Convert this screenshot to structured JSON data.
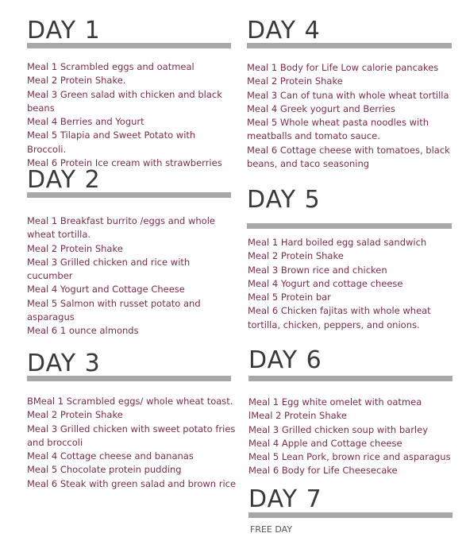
{
  "days": [
    {
      "title": "DAY 1",
      "meals": [
        "Meal 1 Scrambled eggs and oatmeal",
        "Meal 2 Protein Shake.",
        "Meal 3 Green salad with chicken and black beans",
        "Meal 4 Berries and Yogurt",
        "Meal 5 Tilapia and Sweet Potato with Broccoli.",
        "Meal 6 Protein Ice cream with strawberries"
      ]
    },
    {
      "title": "DAY 2",
      "meals": [
        "Meal 1 Breakfast burrito /eggs and whole wheat tortilla.",
        "Meal 2 Protein Shake",
        "Meal 3 Grilled chicken and rice with cucumber",
        "Meal 4 Yogurt and Cottage Cheese",
        "Meal 5 Salmon with russet potato and asparagus",
        "Meal 6 1 ounce almonds"
      ]
    },
    {
      "title": "DAY 3",
      "meals": [
        "BMeal 1 Scrambled eggs/ whole wheat toast.",
        "Meal 2 Protein Shake",
        "Meal 3 Grilled chicken with sweet potato fries and broccoli",
        "Meal 4 Cottage cheese and bananas",
        "Meal 5 Chocolate protein pudding",
        "Meal 6 Steak with green salad and brown rice"
      ]
    },
    {
      "title": "DAY 4",
      "meals": [
        "Meal 1 Body for Life Low calorie pancakes",
        "Meal 2 Protein Shake",
        "Meal 3 Can of tuna with whole wheat tortilla",
        "Meal 4 Greek yogurt and Berries",
        "Meal 5 Whole wheat pasta noodles with meatballs and tomato sauce.",
        "Meal 6 Cottage cheese with tomatoes, black beans, and taco seasoning"
      ]
    },
    {
      "title": "DAY 5",
      "meals": [
        "Meal 1 Hard boiled egg salad sandwich",
        "Meal 2 Protein Shake",
        "Meal 3 Brown rice and chicken",
        "Meal 4 Yogurt and cottage cheese",
        "Meal 5 Protein bar",
        "Meal 6 Chicken fajitas with whole wheat tortilla, chicken, peppers, and onions."
      ]
    },
    {
      "title": "DAY 6",
      "meals": [
        "Meal 1 Egg white omelet with oatmea",
        "lMeal 2 Protein Shake",
        "Meal 3 Grilled chicken soup with barley",
        "Meal 4 Apple and Cottage cheese",
        "Meal 5 Lean Pork, brown rice and asparagus",
        "Meal 6 Body for Life Cheesecake"
      ]
    },
    {
      "title": "DAY 7",
      "meals": [
        "FREE DAY"
      ]
    }
  ],
  "colors": {
    "heading": "#3a3a3a",
    "meal_text": "#7a2d48",
    "divider": "#a8a8a8",
    "background": "#ffffff"
  }
}
